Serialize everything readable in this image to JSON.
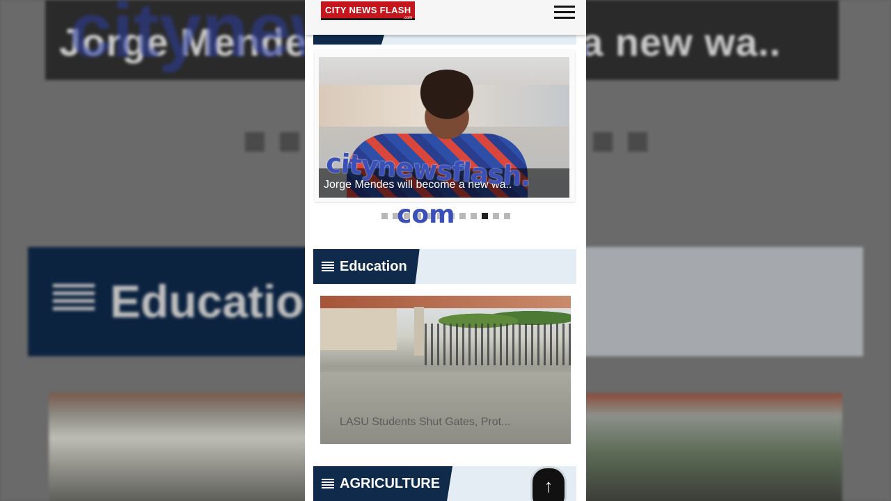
{
  "background": {
    "top_title": "Jorge Mendes will become a new wa..",
    "watermark_partial": "citynewsflash.",
    "section_title": "Education"
  },
  "header": {
    "logo_text": "CITY NEWS FLASH",
    "logo_sub": ".com",
    "menu_icon": "hamburger-icon"
  },
  "slider": {
    "caption": "Jorge Mendes will become a new wa..",
    "dots_count": 12,
    "active_dot_index": 9
  },
  "watermark": {
    "line1": "citynewsflash.",
    "line2": "com"
  },
  "sections": [
    {
      "title": "Education",
      "icon": "list-lines-icon",
      "article": {
        "caption": "LASU Students Shut Gates, Prot..."
      }
    },
    {
      "title": "AGRICULTURE",
      "icon": "list-lines-icon"
    }
  ],
  "scroll_top": {
    "icon": "arrow-up-icon",
    "glyph": "↑"
  },
  "colors": {
    "brand_red": "#c4161c",
    "section_navy": "#0f2a4a",
    "section_band": "#e4edf4",
    "watermark_blue": "#3a4fb8"
  }
}
